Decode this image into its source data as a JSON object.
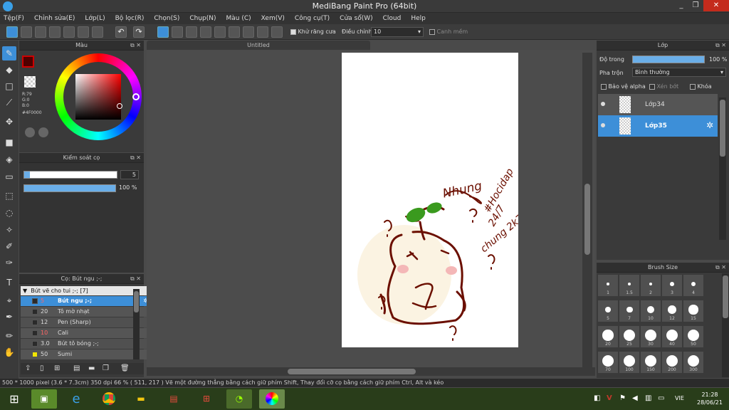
{
  "window": {
    "title": "MediBang Paint Pro (64bit)",
    "min": "_",
    "max": "❐",
    "close": "✕"
  },
  "menu": [
    "Tệp(F)",
    "Chỉnh sửa(E)",
    "Lớp(L)",
    "Bộ lọc(R)",
    "Chọn(S)",
    "Chụp(N)",
    "Màu (C)",
    "Xem(V)",
    "Công cụ(T)",
    "Cửa sổ(W)",
    "Cloud",
    "Help"
  ],
  "toolbar": {
    "antialias_label": "Khử răng cưa",
    "adjust_label": "Điều chỉnh",
    "adjust_value": "10",
    "edge_label": "Canh mềm"
  },
  "color_panel": {
    "title": "Màu",
    "r": "R:79",
    "g": "G:0",
    "b": "B:0",
    "hex": "#4F0000",
    "fg_color": "#4f0000"
  },
  "brush_control": {
    "title": "Kiểm soát cọ",
    "size": "5",
    "opacity": "100 %"
  },
  "brush_panel": {
    "title": "Cọ: Bút ngu ;-;",
    "group": "Bút vẽ cho tui ;-; [7]",
    "items": [
      {
        "size": "5",
        "name": "Bút ngu ;-;",
        "swatch": "#2a2a2a"
      },
      {
        "size": "20",
        "name": "Tô mờ nhạt",
        "swatch": "#2a2a2a"
      },
      {
        "size": "12",
        "name": "Pen (Sharp)",
        "swatch": "#2a2a2a"
      },
      {
        "size": "10",
        "name": "Cali",
        "swatch": "#2a2a2a"
      },
      {
        "size": "3.0",
        "name": "Bút tô bóng ;-;",
        "swatch": "#2a2a2a"
      },
      {
        "size": "50",
        "name": "Sumi",
        "swatch": "#f2e600"
      }
    ]
  },
  "document": {
    "tab": "Untitled"
  },
  "layer_panel": {
    "title": "Lớp",
    "opacity_label": "Độ trong",
    "opacity_value": "100 %",
    "blend_label": "Pha trộn",
    "blend_value": "Bình thường",
    "protect_alpha": "Bảo vệ alpha",
    "clipping": "Xén bớt",
    "lock": "Khóa",
    "layers": [
      {
        "name": "Lớp34",
        "selected": false
      },
      {
        "name": "Lớp35",
        "selected": true
      }
    ]
  },
  "brush_size_panel": {
    "title": "Brush Size",
    "sizes": [
      "1",
      "1.5",
      "2",
      "3",
      "4",
      "5",
      "7",
      "10",
      "12",
      "15",
      "20",
      "25",
      "30",
      "40",
      "50",
      "70",
      "100",
      "150",
      "200",
      "300"
    ]
  },
  "status": {
    "text": "500 * 1000 pixel   (3.6 * 7.3cm)   350 dpi   66 %   ( 511, 217 )   Vẽ một đường thẳng bằng cách giữ phím Shift, Thay đổi cỡ cọ bằng cách giữ phím Ctrl, Alt và kéo"
  },
  "taskbar": {
    "lang": "VIE",
    "time": "21:28",
    "date": "28/06/21"
  },
  "drawing": {
    "signature": "Nhung",
    "hashtag": "#Hocidap",
    "line2": "24/7",
    "line3": "chung 2k7",
    "stroke_color": "#6b0f00",
    "leaf_color": "#3a9a1e",
    "cheek_color": "#f4b7b7"
  }
}
